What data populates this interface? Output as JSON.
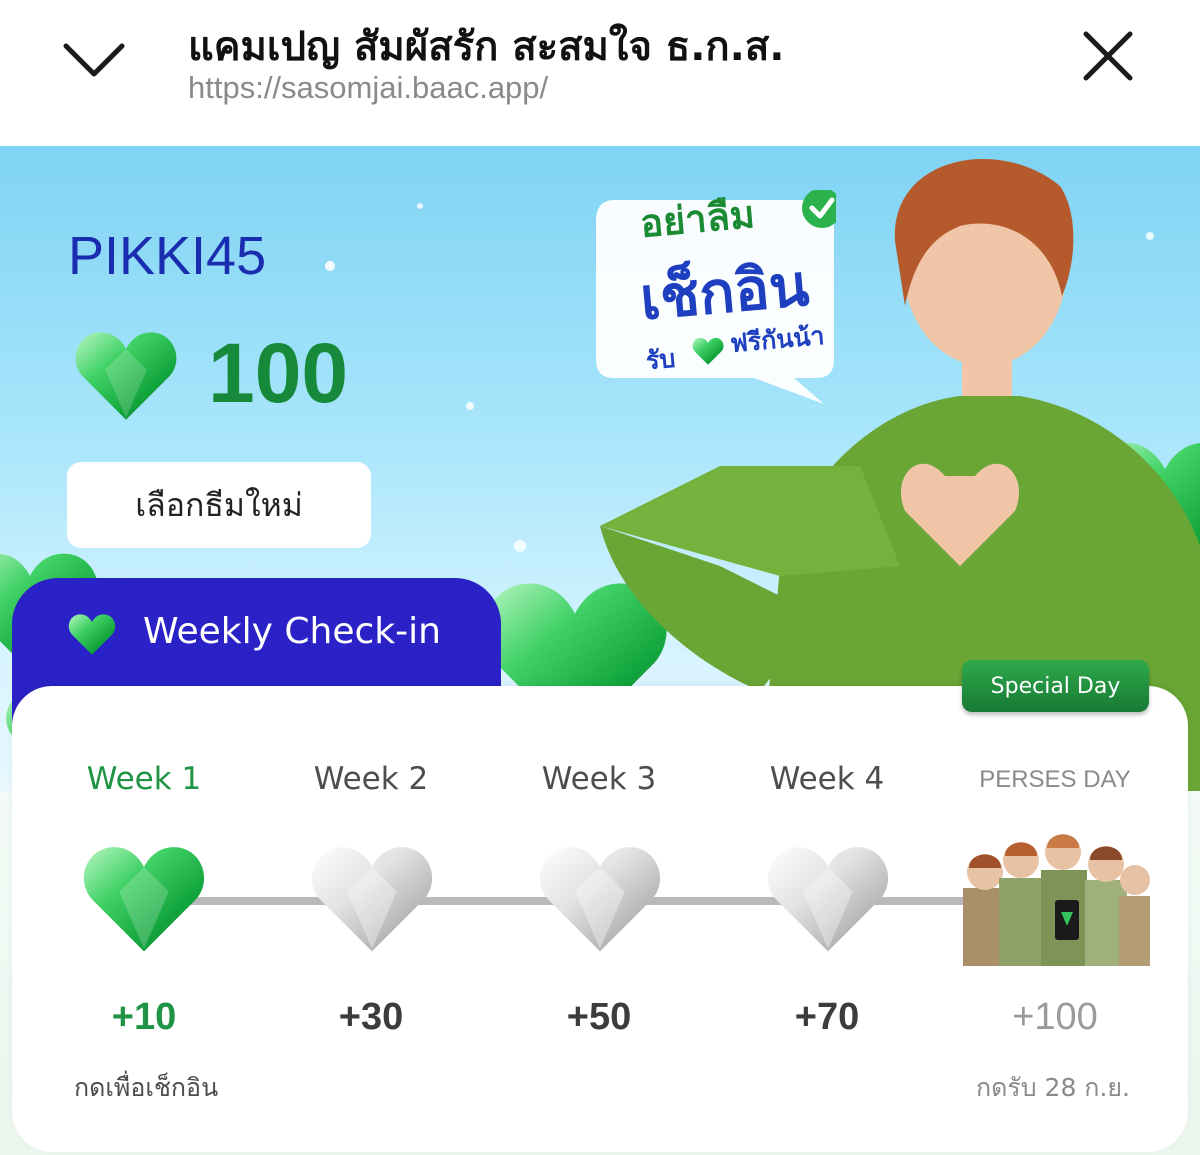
{
  "browser": {
    "title": "แคมเปญ สัมผัสรัก สะสมใจ ธ.ก.ส.",
    "url": "https://sasomjai.baac.app/",
    "collapse_icon": "chevron-down-icon",
    "close_icon": "close-icon"
  },
  "profile": {
    "username": "PIKKI45",
    "gem_balance": "100",
    "gem_icon": "green-heart-gem-icon",
    "theme_button_label": "เลือกธีมใหม่"
  },
  "promo": {
    "line1": "อย่าลืม",
    "line2": "เช็กอิน",
    "line3a": "รับ",
    "line3b": "ฟรีกันน้า",
    "icon": "check-circle-icon"
  },
  "weekly": {
    "title": "Weekly Check-in",
    "special_tag": "Special Day",
    "weeks": [
      {
        "label": "Week 1",
        "points": "+10",
        "state": "active"
      },
      {
        "label": "Week 2",
        "points": "+30",
        "state": "locked"
      },
      {
        "label": "Week 3",
        "points": "+50",
        "state": "locked"
      },
      {
        "label": "Week 4",
        "points": "+70",
        "state": "locked"
      },
      {
        "label": "PERSES DAY",
        "points": "+100",
        "state": "special"
      }
    ],
    "checkin_hint": "กดเพื่อเช็กอิน",
    "special_hint": "กดรับ 28 ก.ย."
  },
  "colors": {
    "brand_blue": "#2a22c6",
    "brand_green": "#1e9444",
    "username_blue": "#1a2caf"
  }
}
